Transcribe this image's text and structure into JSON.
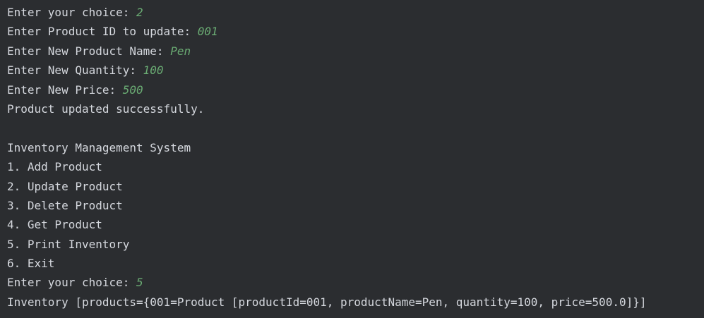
{
  "console": {
    "colors": {
      "background": "#2b2d30",
      "output_text": "#d5d8de",
      "user_input": "#6aab73"
    },
    "lines": [
      {
        "text": "Enter your choice: ",
        "input": "2"
      },
      {
        "text": "Enter Product ID to update: ",
        "input": "001"
      },
      {
        "text": "Enter New Product Name: ",
        "input": "Pen"
      },
      {
        "text": "Enter New Quantity: ",
        "input": "100"
      },
      {
        "text": "Enter New Price: ",
        "input": "500"
      },
      {
        "text": "Product updated successfully.",
        "input": ""
      },
      {
        "text": "",
        "input": ""
      },
      {
        "text": "Inventory Management System",
        "input": ""
      },
      {
        "text": "1. Add Product",
        "input": ""
      },
      {
        "text": "2. Update Product",
        "input": ""
      },
      {
        "text": "3. Delete Product",
        "input": ""
      },
      {
        "text": "4. Get Product",
        "input": ""
      },
      {
        "text": "5. Print Inventory",
        "input": ""
      },
      {
        "text": "6. Exit",
        "input": ""
      },
      {
        "text": "Enter your choice: ",
        "input": "5"
      },
      {
        "text": "Inventory [products={001=Product [productId=001, productName=Pen, quantity=100, price=500.0]}]",
        "input": ""
      }
    ]
  }
}
